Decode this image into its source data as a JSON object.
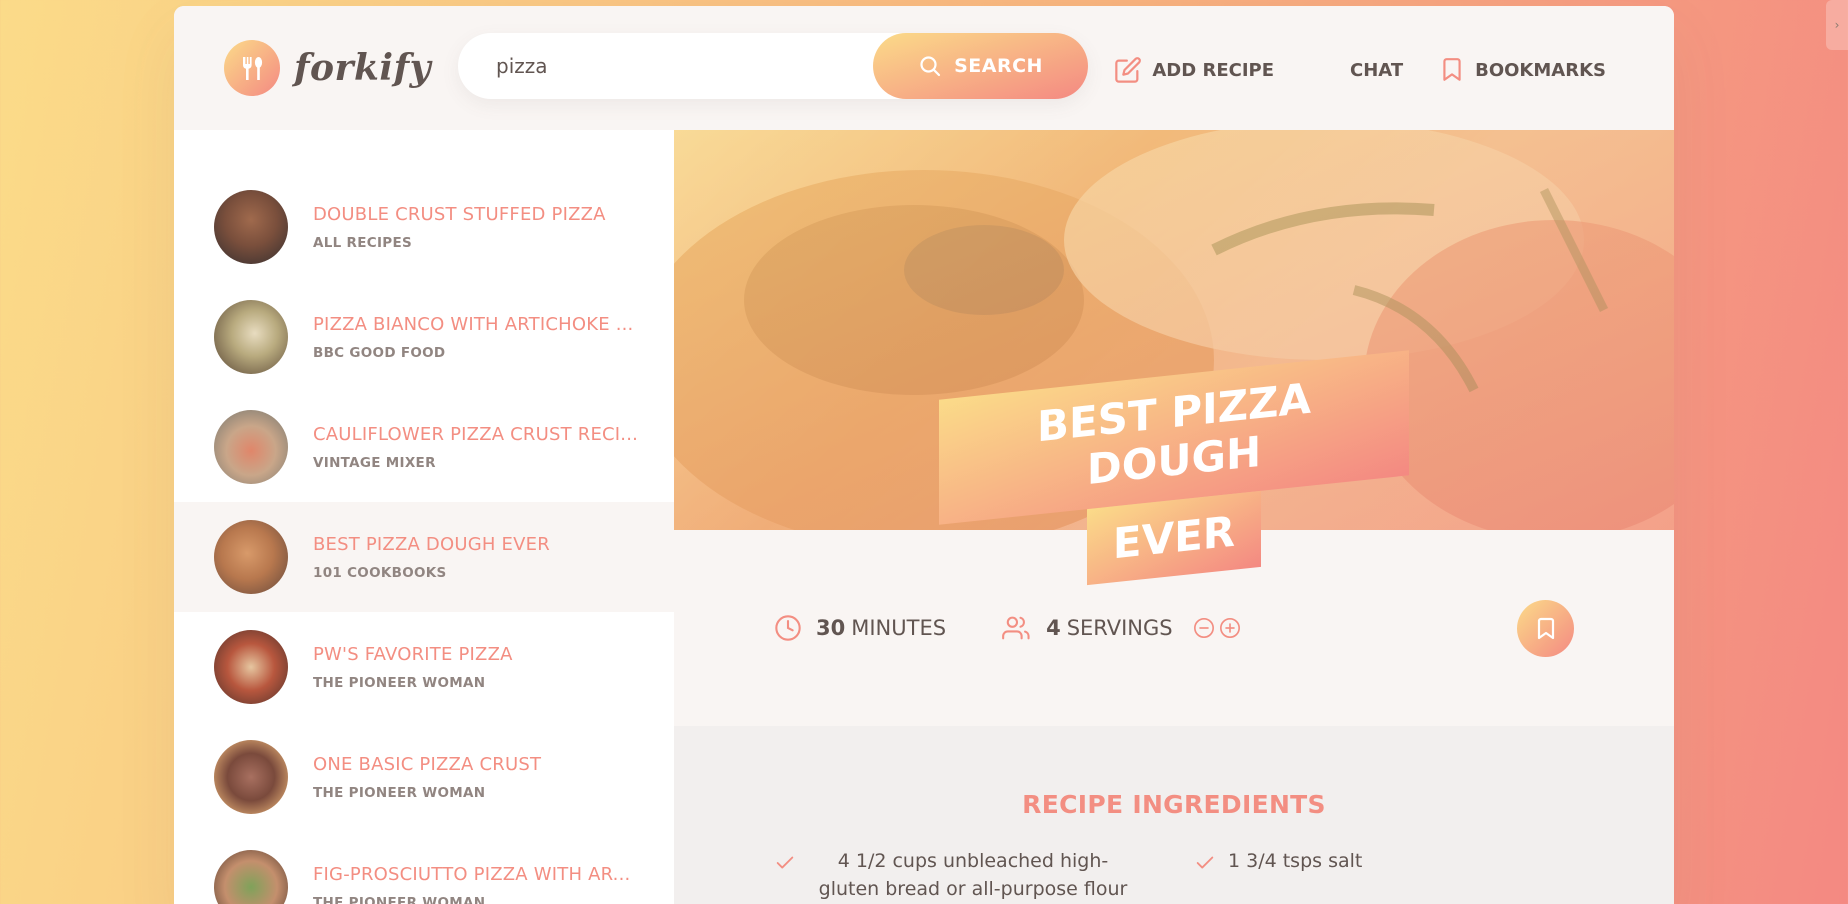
{
  "header": {
    "logo_text": "forkify",
    "search_value": "pizza",
    "search_button_label": "SEARCH",
    "nav": {
      "add_recipe": "ADD RECIPE",
      "chat": "CHAT",
      "bookmarks": "BOOKMARKS"
    }
  },
  "results": [
    {
      "title": "DOUBLE CRUST STUFFED PIZZA",
      "publisher": "ALL RECIPES"
    },
    {
      "title": "PIZZA BIANCO WITH ARTICHOKE ...",
      "publisher": "BBC GOOD FOOD"
    },
    {
      "title": "CAULIFLOWER PIZZA CRUST RECI...",
      "publisher": "VINTAGE MIXER"
    },
    {
      "title": "BEST PIZZA DOUGH EVER",
      "publisher": "101 COOKBOOKS"
    },
    {
      "title": "PW'S FAVORITE PIZZA",
      "publisher": "THE PIONEER WOMAN"
    },
    {
      "title": "ONE BASIC PIZZA CRUST",
      "publisher": "THE PIONEER WOMAN"
    },
    {
      "title": "FIG-PROSCIUTTO PIZZA WITH AR...",
      "publisher": "THE PIONEER WOMAN"
    }
  ],
  "recipe": {
    "title_line1": "BEST PIZZA DOUGH",
    "title_line2": "EVER",
    "cooking_time": "30",
    "cooking_time_unit": "MINUTES",
    "servings": "4",
    "servings_unit": "SERVINGS",
    "ingredients_heading": "RECIPE INGREDIENTS",
    "ingredients": [
      {
        "quantity": "4 1/2",
        "description": "cups unbleached high-gluten bread or all-purpose flour"
      },
      {
        "quantity": "1 3/4",
        "description": "tsps salt"
      }
    ]
  },
  "colors": {
    "accent_start": "#fbdb89",
    "accent_end": "#f48982",
    "title_text": "#f38e82",
    "body_text": "#615551"
  },
  "icons": {
    "logo": "fork-spoon-icon",
    "search": "search-icon",
    "add_recipe": "edit-icon",
    "bookmarks": "bookmark-icon",
    "time": "clock-icon",
    "servings": "users-icon",
    "decrease": "minus-circle-icon",
    "increase": "plus-circle-icon",
    "ingredient": "check-icon"
  }
}
